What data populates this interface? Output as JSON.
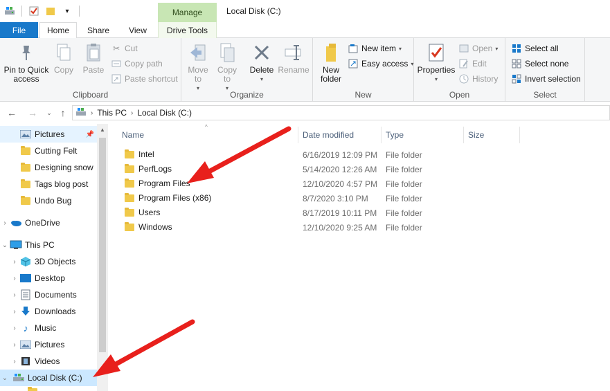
{
  "window": {
    "title": "Local Disk (C:)",
    "context_tab": "Manage"
  },
  "tabs": {
    "file": "File",
    "home": "Home",
    "share": "Share",
    "view": "View",
    "drive_tools": "Drive Tools"
  },
  "ribbon": {
    "clipboard": {
      "label": "Clipboard",
      "pin": "Pin to Quick access",
      "copy": "Copy",
      "paste": "Paste",
      "cut": "Cut",
      "copy_path": "Copy path",
      "paste_shortcut": "Paste shortcut"
    },
    "organize": {
      "label": "Organize",
      "move_to": "Move to",
      "copy_to": "Copy to",
      "delete": "Delete",
      "rename": "Rename"
    },
    "new": {
      "label": "New",
      "new_folder": "New folder",
      "new_item": "New item",
      "easy_access": "Easy access"
    },
    "open": {
      "label": "Open",
      "properties": "Properties",
      "open": "Open",
      "edit": "Edit",
      "history": "History"
    },
    "select": {
      "label": "Select",
      "select_all": "Select all",
      "select_none": "Select none",
      "invert": "Invert selection"
    }
  },
  "address": {
    "crumbs": [
      "This PC",
      "Local Disk (C:)"
    ]
  },
  "nav": {
    "quick": [
      "Pictures",
      "Cutting Felt",
      "Designing snow",
      "Tags blog post",
      "Undo Bug"
    ],
    "onedrive": "OneDrive",
    "this_pc": "This PC",
    "pc_items": [
      "3D Objects",
      "Desktop",
      "Documents",
      "Downloads",
      "Music",
      "Pictures",
      "Videos",
      "Local Disk (C:)"
    ]
  },
  "columns": {
    "name": "Name",
    "date": "Date modified",
    "type": "Type",
    "size": "Size"
  },
  "files": [
    {
      "name": "Intel",
      "date": "6/16/2019 12:09 PM",
      "type": "File folder"
    },
    {
      "name": "PerfLogs",
      "date": "5/14/2020 12:26 AM",
      "type": "File folder"
    },
    {
      "name": "Program Files",
      "date": "12/10/2020 4:57 PM",
      "type": "File folder"
    },
    {
      "name": "Program Files (x86)",
      "date": "8/7/2020 3:10 PM",
      "type": "File folder"
    },
    {
      "name": "Users",
      "date": "8/17/2019 10:11 PM",
      "type": "File folder"
    },
    {
      "name": "Windows",
      "date": "12/10/2020 9:25 AM",
      "type": "File folder"
    }
  ],
  "colors": {
    "accent": "#1979ca",
    "manage": "#c8e6b4",
    "selection": "#cce8ff",
    "annotation_arrow": "#e8201c"
  }
}
